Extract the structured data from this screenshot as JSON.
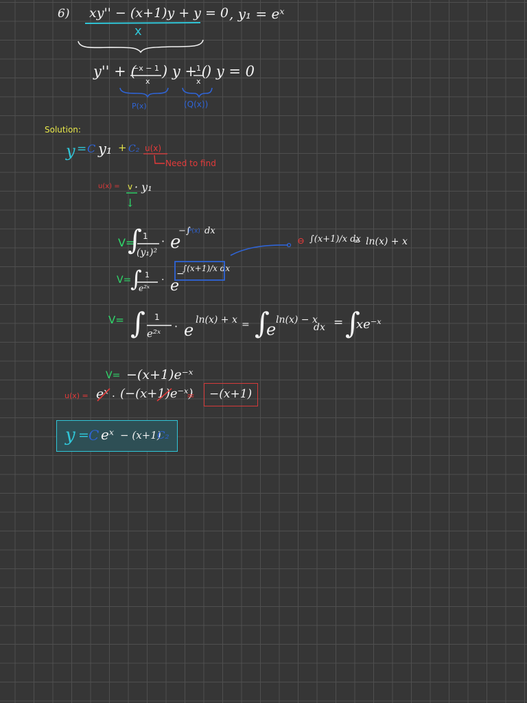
{
  "problem": {
    "number": "6)",
    "ode_numerator": "xy'' − (x+1)y + y = 0",
    "ode_divisor": "x",
    "given": ", y₁ = eˣ"
  },
  "standard_form": {
    "left": "y'' + (",
    "p_frac_num": "−x − 1",
    "p_frac_den": "x",
    "mid": ") y + (",
    "q_frac_num": "1",
    "q_frac_den": "x",
    "right": ") y = 0",
    "p_label": "P(x)",
    "q_label": "(Q(x))"
  },
  "solution": {
    "heading": "Solution:",
    "general_y": "y",
    "general_eq": "=",
    "c1": "C",
    "y1": "y₁",
    "plus": "+",
    "c2": "C₂",
    "u": "u(x)",
    "need_note": "Need to find"
  },
  "u_def": {
    "u": "u(x) =",
    "v": "v",
    "rest": "· y₁",
    "arrow": "↓"
  },
  "v_formula": {
    "v1_lhs": "V=",
    "v1_int": "∫",
    "v1_frac_num": "1",
    "v1_frac_den": "(y₁)²",
    "v1_dot": "·",
    "v1_e": "e",
    "v1_exp_prefix": "−∫",
    "v1_exp_p": "P(x)",
    "v1_exp_dx": "dx",
    "side_circle": "⊖",
    "side_integral": "∫(x+1)/x dx",
    "side_eq": "=",
    "side_result": "ln(x) + x",
    "v2_lhs": "V=",
    "v2_int": "∫",
    "v2_frac_num": "1",
    "v2_frac_den": "e²ˣ",
    "v2_dot": "·",
    "v2_e": "e",
    "v2_exp_minus": "−",
    "v2_exp": "∫(x+1)/x dx"
  },
  "v_eval": {
    "lhs": "V=",
    "int": "∫",
    "frac_num": "1",
    "frac_den": "e²ˣ",
    "dot": "·",
    "e1": "e",
    "e1_exp": "ln(x) + x",
    "eq1": "=",
    "int2": "∫",
    "e2": "e",
    "e2_exp": "ln(x) − x",
    "dx": "dx",
    "eq2": "=",
    "int3": "∫",
    "result": "xe⁻ˣ"
  },
  "v_result": {
    "lhs": "V=",
    "rhs": "−(x+1)e⁻ˣ"
  },
  "u_result": {
    "lhs": "u(x) =",
    "ex": "eˣ",
    "dot": "·",
    "paren": "(−(x+1)e⁻ˣ)",
    "eq": "=",
    "boxed": "−(x+1)"
  },
  "final": {
    "y": "y",
    "eq": "=",
    "c": "C",
    "ex": "eˣ",
    "minus": "− (x+1)",
    "c2": "C₂"
  },
  "colors": {
    "background": "#363636",
    "grid": "#4f4f4f",
    "ink_white": "#f2f2f2",
    "ink_cyan": "#30c6d8",
    "ink_blue": "#2f64d6",
    "ink_green": "#2fd96b",
    "ink_yellow": "#e8e84a",
    "ink_red": "#e33a3a",
    "final_box_fill": "#2e4f55"
  }
}
